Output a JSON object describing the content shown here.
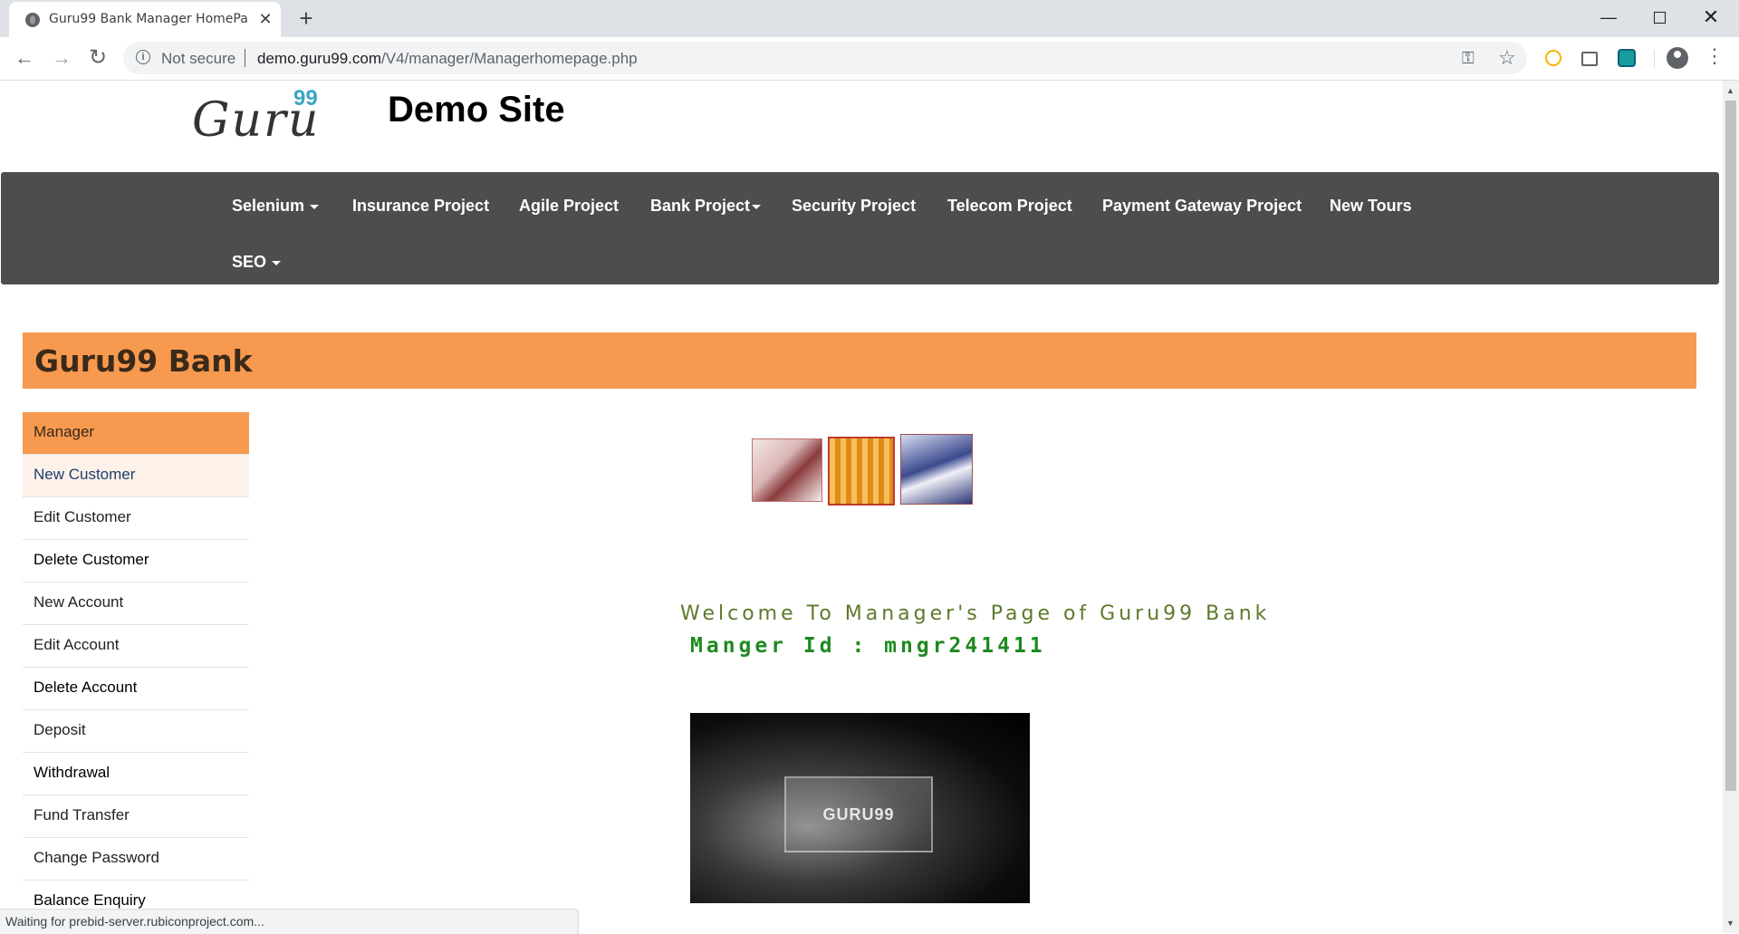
{
  "browser": {
    "tab_title": "Guru99 Bank Manager HomePage",
    "tab_close": "✕",
    "new_tab": "+",
    "security_label": "Not secure",
    "url_host": "demo.guru99.com",
    "url_path": "/V4/manager/Managerhomepage.php",
    "status_text": "Waiting for prebid-server.rubiconproject.com..."
  },
  "header": {
    "logo_text": "Guru",
    "logo_sup": "99",
    "site_title": "Demo Site"
  },
  "navbar": {
    "items": [
      {
        "label": "Selenium",
        "dropdown": true
      },
      {
        "label": "Insurance Project",
        "dropdown": false
      },
      {
        "label": "Agile Project",
        "dropdown": false
      },
      {
        "label": "Bank Project",
        "dropdown": true
      },
      {
        "label": "Security Project",
        "dropdown": false
      },
      {
        "label": "Telecom Project",
        "dropdown": false
      },
      {
        "label": "Payment Gateway Project",
        "dropdown": false
      },
      {
        "label": "New Tours",
        "dropdown": false
      },
      {
        "label": "SEO",
        "dropdown": true
      }
    ]
  },
  "bank": {
    "title": "Guru99 Bank"
  },
  "sidebar": {
    "items": [
      {
        "label": "Manager"
      },
      {
        "label": "New Customer"
      },
      {
        "label": "Edit Customer"
      },
      {
        "label": "Delete Customer"
      },
      {
        "label": "New Account"
      },
      {
        "label": "Edit Account"
      },
      {
        "label": "Delete Account"
      },
      {
        "label": "Deposit"
      },
      {
        "label": "Withdrawal"
      },
      {
        "label": "Fund Transfer"
      },
      {
        "label": "Change Password"
      },
      {
        "label": "Balance Enquiry"
      }
    ]
  },
  "main": {
    "welcome": "Welcome To Manager's Page of Guru99 Bank",
    "manager_id": "Manger Id : mngr241411",
    "promo_text": "GURU99"
  },
  "colors": {
    "accent_orange": "#f7994e",
    "navbar_bg": "#4d4d4d",
    "welcome_green": "#5d7a2a",
    "id_green": "#1f8a1f"
  }
}
